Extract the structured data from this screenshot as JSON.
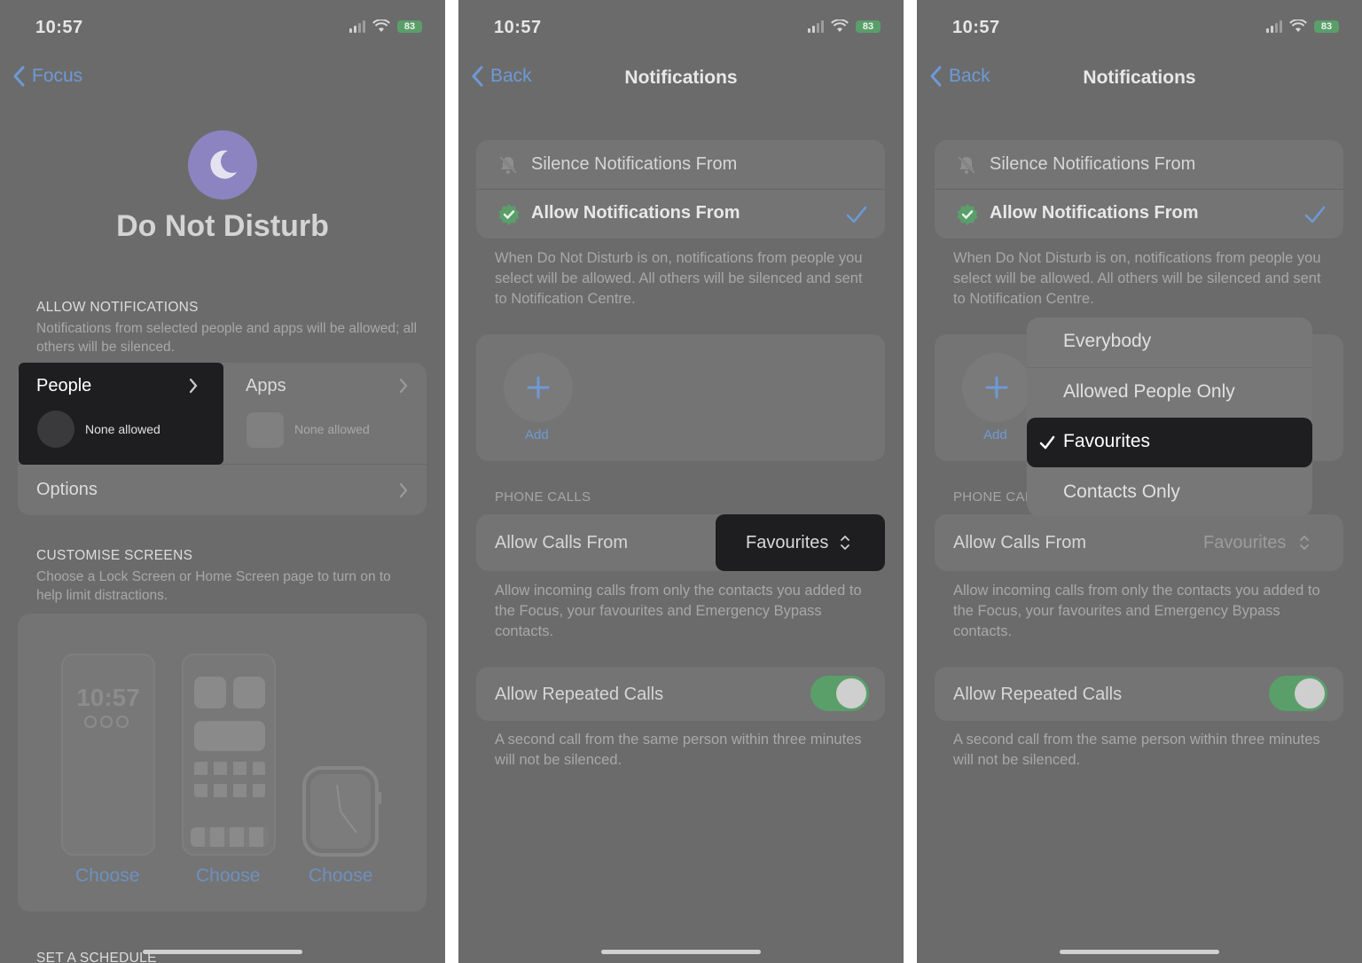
{
  "status": {
    "time": "10:57",
    "battery": "83"
  },
  "panel1": {
    "back_label": "Focus",
    "title": "Do Not Disturb",
    "allow_heading": "ALLOW NOTIFICATIONS",
    "allow_desc": "Notifications from selected people and apps will be allowed; all others will be silenced.",
    "people_label": "People",
    "people_value": "None allowed",
    "apps_label": "Apps",
    "apps_value": "None allowed",
    "options_label": "Options",
    "customise_heading": "CUSTOMISE SCREENS",
    "customise_desc": "Choose a Lock Screen or Home Screen page to turn on to help limit distractions.",
    "lock_time": "10:57",
    "choose_labels": [
      "Choose",
      "Choose",
      "Choose"
    ],
    "schedule_heading": "SET A SCHEDULE"
  },
  "panel2": {
    "back_label": "Back",
    "title": "Notifications",
    "silence_label": "Silence Notifications From",
    "allow_label": "Allow Notifications From",
    "notif_desc": "When Do Not Disturb is on, notifications from people you select will be allowed. All others will be silenced and sent to Notification Centre.",
    "add_label": "Add",
    "phone_calls_heading": "PHONE CALLS",
    "allow_calls_label": "Allow Calls From",
    "allow_calls_value": "Favourites",
    "calls_desc": "Allow incoming calls from only the contacts you added to the Focus, your favourites and Emergency Bypass contacts.",
    "repeated_label": "Allow Repeated Calls",
    "repeated_desc": "A second call from the same person within three minutes will not be silenced."
  },
  "panel3": {
    "back_label": "Back",
    "title": "Notifications",
    "silence_label": "Silence Notifications From",
    "allow_label": "Allow Notifications From",
    "notif_desc": "When Do Not Disturb is on, notifications from people you select will be allowed. All others will be silenced and sent to Notification Centre.",
    "add_label": "Add",
    "phone_calls_heading": "PHONE CAI",
    "allow_calls_label": "Allow Calls From",
    "allow_calls_value": "Favourites",
    "calls_desc": "Allow incoming calls from only the contacts you added to the Focus, your favourites and Emergency Bypass contacts.",
    "repeated_label": "Allow Repeated Calls",
    "repeated_desc": "A second call from the same person within three minutes will not be silenced.",
    "menu": {
      "options": [
        "Everybody",
        "Allowed People Only",
        "Favourites",
        "Contacts Only"
      ],
      "selected": "Favourites"
    }
  },
  "colors": {
    "accent": "#6d9ad6",
    "toggle_on": "#5a9e6a",
    "moon": "#8c84c0",
    "highlight": "#1e1e20"
  },
  "icons": [
    "chevron-left-icon",
    "chevron-right-icon",
    "moon-icon",
    "bell-slash-icon",
    "verified-check-icon",
    "checkmark-icon",
    "plus-icon",
    "up-down-chevron-icon",
    "wifi-icon",
    "signal-icon",
    "battery-icon"
  ]
}
